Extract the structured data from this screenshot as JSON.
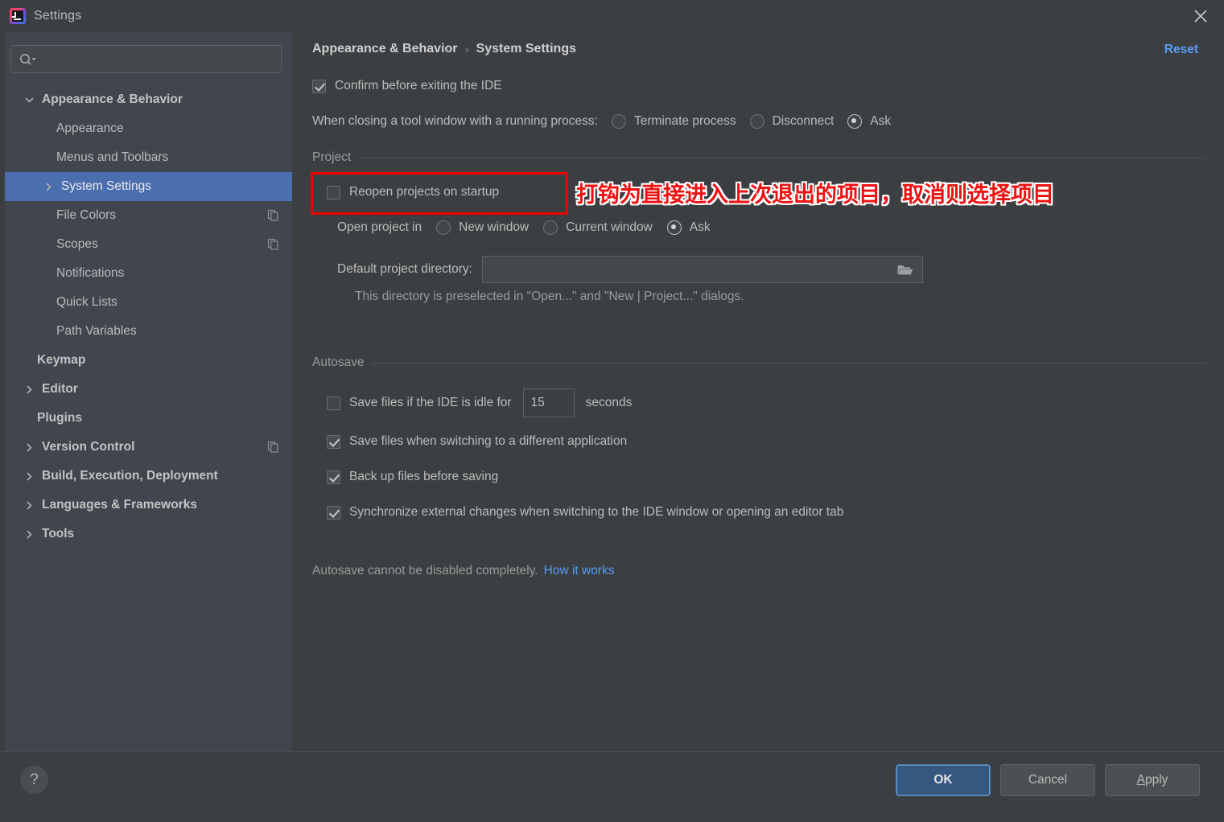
{
  "window": {
    "title": "Settings",
    "app_icon": "intellij-idea-icon",
    "close_icon": "close-icon"
  },
  "search": {
    "value": "",
    "placeholder": "",
    "icon": "search-icon"
  },
  "sidebar": {
    "items": [
      {
        "label": "Appearance & Behavior",
        "level": 0,
        "arrow": "chevron-down-icon",
        "bold": true,
        "selected": false,
        "copy_icon": false
      },
      {
        "label": "Appearance",
        "level": 1,
        "arrow": "",
        "bold": false,
        "selected": false,
        "copy_icon": false
      },
      {
        "label": "Menus and Toolbars",
        "level": 1,
        "arrow": "",
        "bold": false,
        "selected": false,
        "copy_icon": false
      },
      {
        "label": "System Settings",
        "level": 1,
        "arrow": "chevron-right-icon",
        "bold": false,
        "selected": true,
        "copy_icon": false
      },
      {
        "label": "File Colors",
        "level": 1,
        "arrow": "",
        "bold": false,
        "selected": false,
        "copy_icon": true
      },
      {
        "label": "Scopes",
        "level": 1,
        "arrow": "",
        "bold": false,
        "selected": false,
        "copy_icon": true
      },
      {
        "label": "Notifications",
        "level": 1,
        "arrow": "",
        "bold": false,
        "selected": false,
        "copy_icon": false
      },
      {
        "label": "Quick Lists",
        "level": 1,
        "arrow": "",
        "bold": false,
        "selected": false,
        "copy_icon": false
      },
      {
        "label": "Path Variables",
        "level": 1,
        "arrow": "",
        "bold": false,
        "selected": false,
        "copy_icon": false
      },
      {
        "label": "Keymap",
        "level": 0,
        "arrow": "",
        "bold": true,
        "selected": false,
        "copy_icon": false
      },
      {
        "label": "Editor",
        "level": 0,
        "arrow": "chevron-right-icon",
        "bold": true,
        "selected": false,
        "copy_icon": false
      },
      {
        "label": "Plugins",
        "level": 0,
        "arrow": "",
        "bold": true,
        "selected": false,
        "copy_icon": false
      },
      {
        "label": "Version Control",
        "level": 0,
        "arrow": "chevron-right-icon",
        "bold": true,
        "selected": false,
        "copy_icon": true
      },
      {
        "label": "Build, Execution, Deployment",
        "level": 0,
        "arrow": "chevron-right-icon",
        "bold": true,
        "selected": false,
        "copy_icon": false
      },
      {
        "label": "Languages & Frameworks",
        "level": 0,
        "arrow": "chevron-right-icon",
        "bold": true,
        "selected": false,
        "copy_icon": false
      },
      {
        "label": "Tools",
        "level": 0,
        "arrow": "chevron-right-icon",
        "bold": true,
        "selected": false,
        "copy_icon": false
      }
    ]
  },
  "main": {
    "breadcrumb": {
      "parent": "Appearance & Behavior",
      "separator": "›",
      "current": "System Settings"
    },
    "reset_label": "Reset",
    "confirm_exit": {
      "label": "Confirm before exiting the IDE",
      "checked": true
    },
    "closing_tool_window": {
      "label": "When closing a tool window with a running process:",
      "options": [
        {
          "label": "Terminate process",
          "selected": false
        },
        {
          "label": "Disconnect",
          "selected": false
        },
        {
          "label": "Ask",
          "selected": true
        }
      ]
    },
    "project_group": {
      "title": "Project",
      "reopen": {
        "label": "Reopen projects on startup",
        "checked": false
      },
      "open_project_in": {
        "label": "Open project in",
        "options": [
          {
            "label": "New window",
            "selected": false
          },
          {
            "label": "Current window",
            "selected": false
          },
          {
            "label": "Ask",
            "selected": true
          }
        ]
      },
      "default_dir": {
        "label": "Default project directory:",
        "value": "",
        "browse_icon": "folder-icon",
        "hint": "This directory is preselected in \"Open...\" and \"New | Project...\" dialogs."
      }
    },
    "autosave_group": {
      "title": "Autosave",
      "idle": {
        "label": "Save files if the IDE is idle for",
        "checked": false,
        "seconds_value": "15",
        "seconds_suffix": "seconds"
      },
      "items": [
        {
          "label": "Save files when switching to a different application",
          "checked": true
        },
        {
          "label": "Back up files before saving",
          "checked": true
        },
        {
          "label": "Synchronize external changes when switching to the IDE window or opening an editor tab",
          "checked": true
        }
      ],
      "note_text": "Autosave cannot be disabled completely.",
      "note_link": "How it works"
    },
    "annotation": {
      "text": "打钩为直接进入上次退出的项目，取消则选择项目",
      "color": "#ee1111",
      "outline_color": "#ffffff",
      "box_color": "#f00000"
    }
  },
  "footer": {
    "help_glyph": "?",
    "ok_label": "OK",
    "cancel_label": "Cancel",
    "apply_label_prefix": "A",
    "apply_label_rest": "pply"
  },
  "colors": {
    "sidebar_bg": "#41454d",
    "main_bg": "#3c3f41",
    "selection": "#4b6eaf",
    "link": "#589df6",
    "text": "#bbbbbb"
  }
}
